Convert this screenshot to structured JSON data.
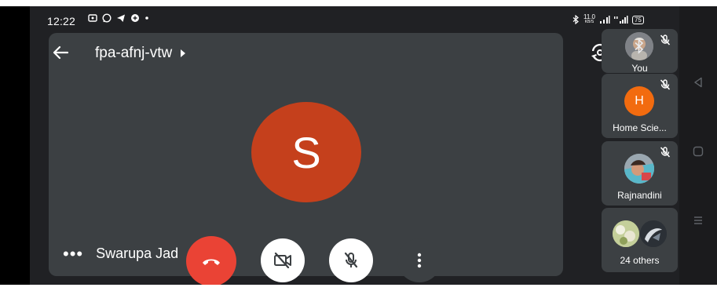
{
  "status_bar": {
    "time": "12:22",
    "net_speed_value": "11.0",
    "net_speed_unit": "KB/S",
    "battery": "75"
  },
  "header": {
    "meeting_code": "fpa-afnj-vtw"
  },
  "main": {
    "avatar_initial": "S",
    "avatar_color": "#c5401c",
    "speaker_name": "Swarupa Jad"
  },
  "participants": [
    {
      "label": "You",
      "muted": true
    },
    {
      "label": "Home Scie...",
      "initial": "H",
      "avatar_color": "#f26b0f",
      "muted": true
    },
    {
      "label": "Rajnandini",
      "muted": true
    },
    {
      "label": "24 others"
    }
  ],
  "controls": {
    "end_call_color": "#ea4335"
  }
}
